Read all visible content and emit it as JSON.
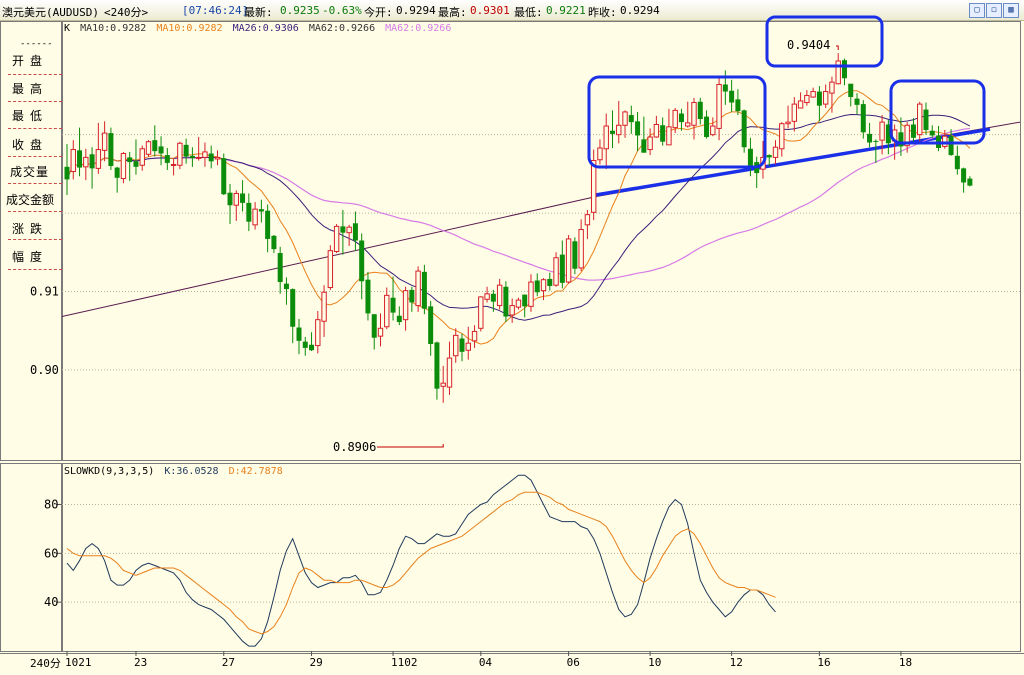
{
  "header": {
    "instrument": "澳元美元(AUDUSD)",
    "period": "<240分>",
    "time": "[07:46:24]",
    "latest_label": "最新:",
    "latest_value": "0.9235",
    "change": "-0.63%",
    "open_label": "今开:",
    "open_value": "0.9294",
    "high_label": "最高:",
    "high_value": "0.9301",
    "low_label": "最低:",
    "low_value": "0.9221",
    "prev_label": "昨收:",
    "prev_value": "0.9294"
  },
  "window_buttons": [
    "restore-icon",
    "maximize-icon",
    "close-icon"
  ],
  "sidebar": {
    "dashes": "------",
    "items": [
      "开盘",
      "最高",
      "最低",
      "收盘",
      "成交量",
      "成交金额",
      "涨跌",
      "幅度"
    ]
  },
  "main_legend": {
    "k": "K",
    "ma10a": "MA10:0.9282",
    "ma10b": "MA10:0.9282",
    "ma26": "MA26:0.9306",
    "ma62a": "MA62:0.9266",
    "ma62b": "MA62:0.9266"
  },
  "kd_legend": {
    "name": "SLOWKD(9,3,3,5)",
    "k": "K:36.0528",
    "d": "D:42.7878"
  },
  "annotations": {
    "high": "0.9404",
    "low": "0.8906"
  },
  "footer": {
    "period": "240分"
  },
  "chart_data": [
    {
      "type": "candlestick",
      "title": "澳元美元(AUDUSD) 240分",
      "ylim": [
        0.8885,
        0.9445
      ],
      "y_ticks": [
        "0.91",
        "0.90"
      ],
      "x_ticks": [
        "1021",
        "23",
        "27",
        "29",
        "1102",
        "04",
        "06",
        "10",
        "12",
        "16",
        "18"
      ],
      "candles": [
        [
          0.9259,
          0.9243,
          0.9223,
          0.9288
        ],
        [
          0.9253,
          0.9281,
          0.9243,
          0.9293
        ],
        [
          0.928,
          0.9258,
          0.9247,
          0.9309
        ],
        [
          0.9259,
          0.9271,
          0.9242,
          0.9282
        ],
        [
          0.9275,
          0.9257,
          0.9231,
          0.9284
        ],
        [
          0.9257,
          0.9281,
          0.925,
          0.9315
        ],
        [
          0.928,
          0.9302,
          0.9266,
          0.9317
        ],
        [
          0.9302,
          0.926,
          0.9255,
          0.9309
        ],
        [
          0.9258,
          0.9245,
          0.9226,
          0.9259
        ],
        [
          0.9244,
          0.9276,
          0.9238,
          0.9278
        ],
        [
          0.9271,
          0.9265,
          0.9241,
          0.9278
        ],
        [
          0.9266,
          0.9259,
          0.9249,
          0.9294
        ],
        [
          0.9261,
          0.9282,
          0.9254,
          0.9286
        ],
        [
          0.9275,
          0.9291,
          0.9272,
          0.9293
        ],
        [
          0.9293,
          0.9279,
          0.9272,
          0.9312
        ],
        [
          0.9285,
          0.9276,
          0.9261,
          0.9298
        ],
        [
          0.9274,
          0.9264,
          0.9255,
          0.9283
        ],
        [
          0.9261,
          0.9262,
          0.9248,
          0.9269
        ],
        [
          0.9261,
          0.9289,
          0.9256,
          0.9291
        ],
        [
          0.9287,
          0.9272,
          0.9263,
          0.9295
        ],
        [
          0.9273,
          0.927,
          0.9259,
          0.9284
        ],
        [
          0.927,
          0.9271,
          0.9267,
          0.9297
        ],
        [
          0.9271,
          0.9278,
          0.9259,
          0.929
        ],
        [
          0.9276,
          0.9266,
          0.9257,
          0.9286
        ],
        [
          0.9269,
          0.9271,
          0.9261,
          0.928
        ],
        [
          0.927,
          0.9224,
          0.9223,
          0.9276
        ],
        [
          0.9226,
          0.921,
          0.9186,
          0.9237
        ],
        [
          0.921,
          0.9225,
          0.919,
          0.9229
        ],
        [
          0.9225,
          0.9213,
          0.9202,
          0.9242
        ],
        [
          0.9213,
          0.9189,
          0.9177,
          0.9225
        ],
        [
          0.9185,
          0.9205,
          0.9179,
          0.9214
        ],
        [
          0.9205,
          0.9202,
          0.9188,
          0.9217
        ],
        [
          0.9203,
          0.9167,
          0.915,
          0.9211
        ],
        [
          0.9171,
          0.9154,
          0.9149,
          0.9172
        ],
        [
          0.9149,
          0.9112,
          0.9097,
          0.9157
        ],
        [
          0.911,
          0.9103,
          0.9083,
          0.9118
        ],
        [
          0.9103,
          0.9055,
          0.9034,
          0.9104
        ],
        [
          0.9054,
          0.9037,
          0.902,
          0.9065
        ],
        [
          0.9036,
          0.9028,
          0.9018,
          0.9042
        ],
        [
          0.9032,
          0.9025,
          0.9024,
          0.9048
        ],
        [
          0.9031,
          0.9064,
          0.9021,
          0.9075
        ],
        [
          0.9062,
          0.9099,
          0.9042,
          0.9108
        ],
        [
          0.9105,
          0.9152,
          0.9102,
          0.9159
        ],
        [
          0.9151,
          0.9183,
          0.9149,
          0.9186
        ],
        [
          0.9183,
          0.9175,
          0.9147,
          0.9204
        ],
        [
          0.9175,
          0.9182,
          0.9158,
          0.9185
        ],
        [
          0.9187,
          0.9165,
          0.9152,
          0.9202
        ],
        [
          0.9165,
          0.9113,
          0.909,
          0.9174
        ],
        [
          0.9115,
          0.9072,
          0.9063,
          0.9125
        ],
        [
          0.9071,
          0.9041,
          0.9026,
          0.9071
        ],
        [
          0.9043,
          0.9053,
          0.903,
          0.9072
        ],
        [
          0.9055,
          0.9095,
          0.9052,
          0.9105
        ],
        [
          0.9092,
          0.9073,
          0.9063,
          0.9119
        ],
        [
          0.9069,
          0.9061,
          0.9057,
          0.9081
        ],
        [
          0.9064,
          0.9101,
          0.905,
          0.9106
        ],
        [
          0.9102,
          0.9086,
          0.9074,
          0.9106
        ],
        [
          0.9082,
          0.9126,
          0.9074,
          0.9132
        ],
        [
          0.9125,
          0.9078,
          0.9071,
          0.9134
        ],
        [
          0.9081,
          0.9033,
          0.9018,
          0.9088
        ],
        [
          0.9035,
          0.8976,
          0.8962,
          0.9036
        ],
        [
          0.8979,
          0.8983,
          0.8958,
          0.9005
        ],
        [
          0.8978,
          0.9015,
          0.8968,
          0.9036
        ],
        [
          0.9018,
          0.9044,
          0.9009,
          0.9053
        ],
        [
          0.904,
          0.9023,
          0.9011,
          0.9046
        ],
        [
          0.9025,
          0.9034,
          0.9013,
          0.9055
        ],
        [
          0.9037,
          0.9049,
          0.9028,
          0.9057
        ],
        [
          0.9053,
          0.9093,
          0.9049,
          0.9094
        ],
        [
          0.909,
          0.9097,
          0.9086,
          0.9106
        ],
        [
          0.9097,
          0.9087,
          0.9074,
          0.9102
        ],
        [
          0.9082,
          0.9108,
          0.9077,
          0.9116
        ],
        [
          0.9106,
          0.9068,
          0.9061,
          0.9113
        ],
        [
          0.907,
          0.9082,
          0.906,
          0.9091
        ],
        [
          0.908,
          0.9089,
          0.9077,
          0.9092
        ],
        [
          0.9096,
          0.9081,
          0.9067,
          0.9096
        ],
        [
          0.9081,
          0.9112,
          0.9074,
          0.9122
        ],
        [
          0.9114,
          0.9099,
          0.9094,
          0.9123
        ],
        [
          0.9101,
          0.9115,
          0.9089,
          0.9117
        ],
        [
          0.9116,
          0.9107,
          0.9101,
          0.9124
        ],
        [
          0.9108,
          0.9143,
          0.9106,
          0.915
        ],
        [
          0.9147,
          0.9111,
          0.9104,
          0.9165
        ],
        [
          0.9112,
          0.9167,
          0.911,
          0.9172
        ],
        [
          0.9164,
          0.9129,
          0.9122,
          0.9169
        ],
        [
          0.913,
          0.9179,
          0.9126,
          0.9192
        ],
        [
          0.9185,
          0.9198,
          0.9167,
          0.9204
        ],
        [
          0.9201,
          0.9267,
          0.9191,
          0.9281
        ],
        [
          0.9268,
          0.9283,
          0.9262,
          0.9294
        ],
        [
          0.9282,
          0.9311,
          0.9256,
          0.9327
        ],
        [
          0.9305,
          0.9301,
          0.9283,
          0.9331
        ],
        [
          0.93,
          0.9312,
          0.9289,
          0.9343
        ],
        [
          0.9312,
          0.9329,
          0.9296,
          0.9331
        ],
        [
          0.9325,
          0.9316,
          0.9301,
          0.9337
        ],
        [
          0.9317,
          0.9299,
          0.9279,
          0.9329
        ],
        [
          0.9294,
          0.9277,
          0.9277,
          0.9323
        ],
        [
          0.9281,
          0.9297,
          0.9274,
          0.9308
        ],
        [
          0.9297,
          0.9313,
          0.9296,
          0.9324
        ],
        [
          0.9312,
          0.9291,
          0.9286,
          0.9322
        ],
        [
          0.9287,
          0.931,
          0.9287,
          0.9333
        ],
        [
          0.9309,
          0.9331,
          0.9302,
          0.9334
        ],
        [
          0.9327,
          0.9316,
          0.9305,
          0.9333
        ],
        [
          0.9311,
          0.9315,
          0.9309,
          0.9342
        ],
        [
          0.9312,
          0.9341,
          0.9294,
          0.9347
        ],
        [
          0.9342,
          0.932,
          0.9313,
          0.9347
        ],
        [
          0.9323,
          0.9297,
          0.9295,
          0.9331
        ],
        [
          0.93,
          0.9311,
          0.9298,
          0.9322
        ],
        [
          0.9308,
          0.9364,
          0.9293,
          0.9372
        ],
        [
          0.9364,
          0.9355,
          0.9338,
          0.9382
        ],
        [
          0.9356,
          0.9341,
          0.9329,
          0.937
        ],
        [
          0.9345,
          0.933,
          0.9325,
          0.9358
        ],
        [
          0.9331,
          0.9284,
          0.9277,
          0.9332
        ],
        [
          0.9282,
          0.9258,
          0.9247,
          0.9296
        ],
        [
          0.9265,
          0.9251,
          0.9232,
          0.9272
        ],
        [
          0.9256,
          0.9271,
          0.9244,
          0.9292
        ],
        [
          0.9274,
          0.9271,
          0.926,
          0.9275
        ],
        [
          0.9271,
          0.9284,
          0.9262,
          0.9293
        ],
        [
          0.9282,
          0.9314,
          0.9272,
          0.9316
        ],
        [
          0.9314,
          0.9316,
          0.9308,
          0.9337
        ],
        [
          0.9317,
          0.9339,
          0.9304,
          0.9348
        ],
        [
          0.9334,
          0.9343,
          0.9334,
          0.9354
        ],
        [
          0.9341,
          0.935,
          0.9337,
          0.9357
        ],
        [
          0.9348,
          0.9355,
          0.9347,
          0.936
        ],
        [
          0.9355,
          0.9337,
          0.9317,
          0.9362
        ],
        [
          0.9339,
          0.9355,
          0.9334,
          0.9364
        ],
        [
          0.9353,
          0.9367,
          0.9328,
          0.9374
        ],
        [
          0.9365,
          0.9394,
          0.9364,
          0.9404
        ],
        [
          0.9395,
          0.9372,
          0.9363,
          0.9397
        ],
        [
          0.9365,
          0.9348,
          0.9336,
          0.9364
        ],
        [
          0.9346,
          0.9338,
          0.9326,
          0.9353
        ],
        [
          0.9339,
          0.9303,
          0.9295,
          0.9344
        ],
        [
          0.9301,
          0.929,
          0.9284,
          0.9315
        ],
        [
          0.9292,
          0.9291,
          0.9264,
          0.9294
        ],
        [
          0.9293,
          0.9316,
          0.9275,
          0.9325
        ],
        [
          0.9313,
          0.9289,
          0.9275,
          0.9319
        ],
        [
          0.9292,
          0.9306,
          0.9268,
          0.9313
        ],
        [
          0.9303,
          0.9285,
          0.9273,
          0.9322
        ],
        [
          0.9286,
          0.9312,
          0.9277,
          0.9316
        ],
        [
          0.9313,
          0.9296,
          0.929,
          0.9321
        ],
        [
          0.93,
          0.9339,
          0.9289,
          0.9342
        ],
        [
          0.9332,
          0.9306,
          0.93,
          0.9341
        ],
        [
          0.9305,
          0.9299,
          0.9296,
          0.9312
        ],
        [
          0.9299,
          0.9283,
          0.9279,
          0.9311
        ],
        [
          0.9285,
          0.9298,
          0.9282,
          0.9306
        ],
        [
          0.9298,
          0.9274,
          0.9273,
          0.9307
        ],
        [
          0.9273,
          0.9256,
          0.9249,
          0.9286
        ],
        [
          0.9257,
          0.9239,
          0.9226,
          0.9258
        ],
        [
          0.9244,
          0.9235,
          0.9234,
          0.9247
        ]
      ]
    },
    {
      "type": "line",
      "title": "SLOWKD(9,3,3,5)",
      "ylim": [
        20,
        97
      ],
      "y_ticks": [
        "80",
        "60",
        "40"
      ],
      "series": [
        {
          "name": "K",
          "color": "#1f3a5c",
          "values": [
            56,
            53,
            57,
            62,
            64,
            62,
            57,
            49,
            47,
            47,
            49,
            53,
            55,
            56,
            55,
            54,
            53,
            52,
            49,
            44,
            41,
            39,
            38,
            37,
            35,
            33,
            30,
            27,
            24,
            22,
            22,
            25,
            32,
            42,
            53,
            61,
            66,
            59,
            52,
            48,
            46,
            47,
            48,
            48,
            50,
            50,
            51,
            48,
            43,
            43,
            44,
            49,
            55,
            62,
            67,
            66,
            64,
            64,
            66,
            68,
            67,
            67,
            68,
            72,
            76,
            78,
            80,
            81,
            84,
            86,
            88,
            90,
            92,
            92,
            90,
            85,
            80,
            75,
            74,
            73,
            73,
            73,
            71,
            70,
            66,
            60,
            52,
            44,
            37,
            34,
            35,
            39,
            48,
            58,
            66,
            73,
            79,
            82,
            80,
            72,
            60,
            49,
            44,
            40,
            37,
            34,
            36,
            40,
            43,
            45,
            45,
            43,
            39,
            36
          ]
        },
        {
          "name": "D",
          "color": "#e8811c",
          "values": [
            62,
            60,
            59,
            59,
            59,
            59,
            59,
            58,
            56,
            53,
            52,
            51,
            52,
            53,
            54,
            54,
            54,
            54,
            53,
            51,
            49,
            47,
            45,
            43,
            41,
            39,
            37,
            34,
            32,
            29,
            28,
            27,
            28,
            30,
            34,
            39,
            46,
            52,
            54,
            53,
            51,
            49,
            49,
            48,
            48,
            48,
            49,
            49,
            48,
            47,
            46,
            46,
            47,
            49,
            52,
            55,
            58,
            60,
            62,
            63,
            64,
            65,
            66,
            67,
            69,
            71,
            73,
            75,
            77,
            79,
            81,
            82,
            84,
            85,
            85,
            85,
            84,
            83,
            81,
            80,
            78,
            77,
            76,
            75,
            74,
            73,
            71,
            67,
            62,
            57,
            53,
            50,
            48,
            50,
            54,
            59,
            63,
            67,
            69,
            70,
            68,
            64,
            59,
            54,
            50,
            48,
            47,
            46,
            46,
            45,
            45,
            44,
            43,
            42
          ]
        }
      ]
    }
  ]
}
